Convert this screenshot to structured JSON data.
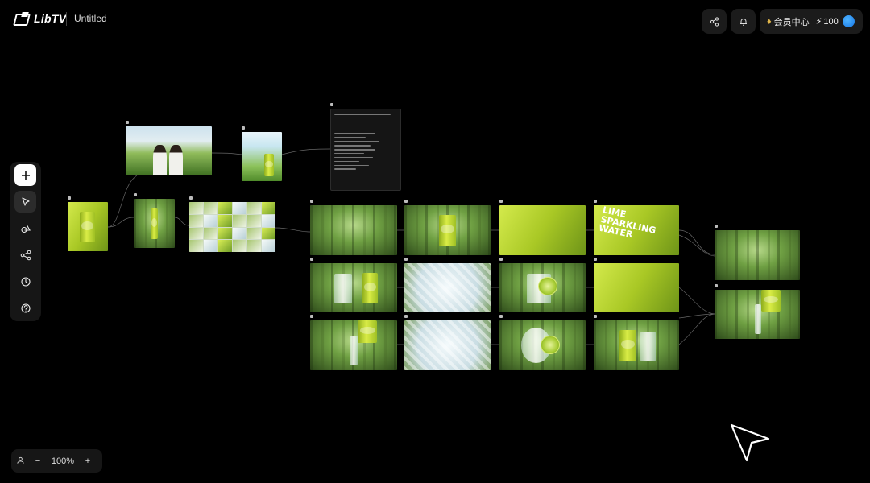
{
  "app": {
    "brand": "LibTV",
    "title": "Untitled"
  },
  "header": {
    "share_icon": "share-icon",
    "bell_icon": "bell-icon",
    "member_label": "会员中心",
    "credits": "100",
    "crown_icon": "crown-icon",
    "bolt_icon": "bolt-icon",
    "avatar_color": "#2a8cf5"
  },
  "toolbar": {
    "items": [
      {
        "name": "add",
        "icon": "plus-icon"
      },
      {
        "name": "select",
        "icon": "cursor-icon"
      },
      {
        "name": "shapes",
        "icon": "shapes-icon"
      },
      {
        "name": "workflow",
        "icon": "nodes-icon"
      },
      {
        "name": "history",
        "icon": "clock-icon"
      },
      {
        "name": "help",
        "icon": "help-icon"
      }
    ]
  },
  "zoom": {
    "value": "100%",
    "minus": "−",
    "plus": "+"
  },
  "canvas": {
    "accent": "#c9e03c"
  }
}
